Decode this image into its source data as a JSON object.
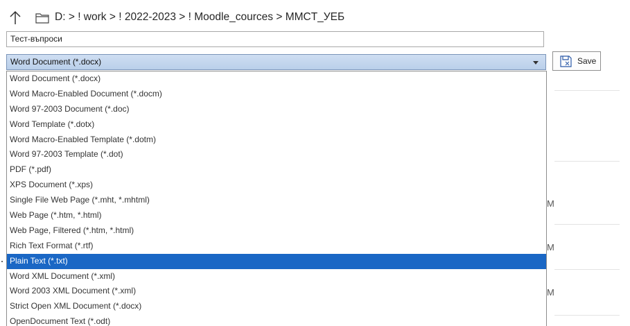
{
  "path": {
    "segments": [
      "D:",
      "! work",
      "! 2022-2023",
      "! Moodle_cources",
      "MMCT_УЕБ"
    ],
    "separator": ">"
  },
  "filename": {
    "value": "Тест-въпроси"
  },
  "filetype": {
    "selected": "Word Document (*.docx)",
    "options": [
      "Word Document (*.docx)",
      "Word Macro-Enabled Document (*.docm)",
      "Word 97-2003 Document (*.doc)",
      "Word Template (*.dotx)",
      "Word Macro-Enabled Template (*.dotm)",
      "Word 97-2003 Template (*.dot)",
      "PDF (*.pdf)",
      "XPS Document (*.xps)",
      "Single File Web Page (*.mht, *.mhtml)",
      "Web Page (*.htm, *.html)",
      "Web Page, Filtered (*.htm, *.html)",
      "Rich Text Format (*.rtf)",
      "Plain Text (*.txt)",
      "Word XML Document (*.xml)",
      "Word 2003 XML Document (*.xml)",
      "Strict Open XML Document (*.docx)",
      "OpenDocument Text (*.odt)"
    ],
    "highlighted_index": 12
  },
  "save_button": {
    "label": "Save"
  },
  "background_list": {
    "truncated_labels": [
      "M",
      "M",
      "M"
    ]
  },
  "colors": {
    "highlight": "#1a67c5",
    "select_bg": "#c5d8f0"
  },
  "icons": {
    "up": "arrow-up-icon",
    "folder": "folder-icon",
    "save": "save-icon",
    "dropdown": "chevron-down-icon"
  }
}
